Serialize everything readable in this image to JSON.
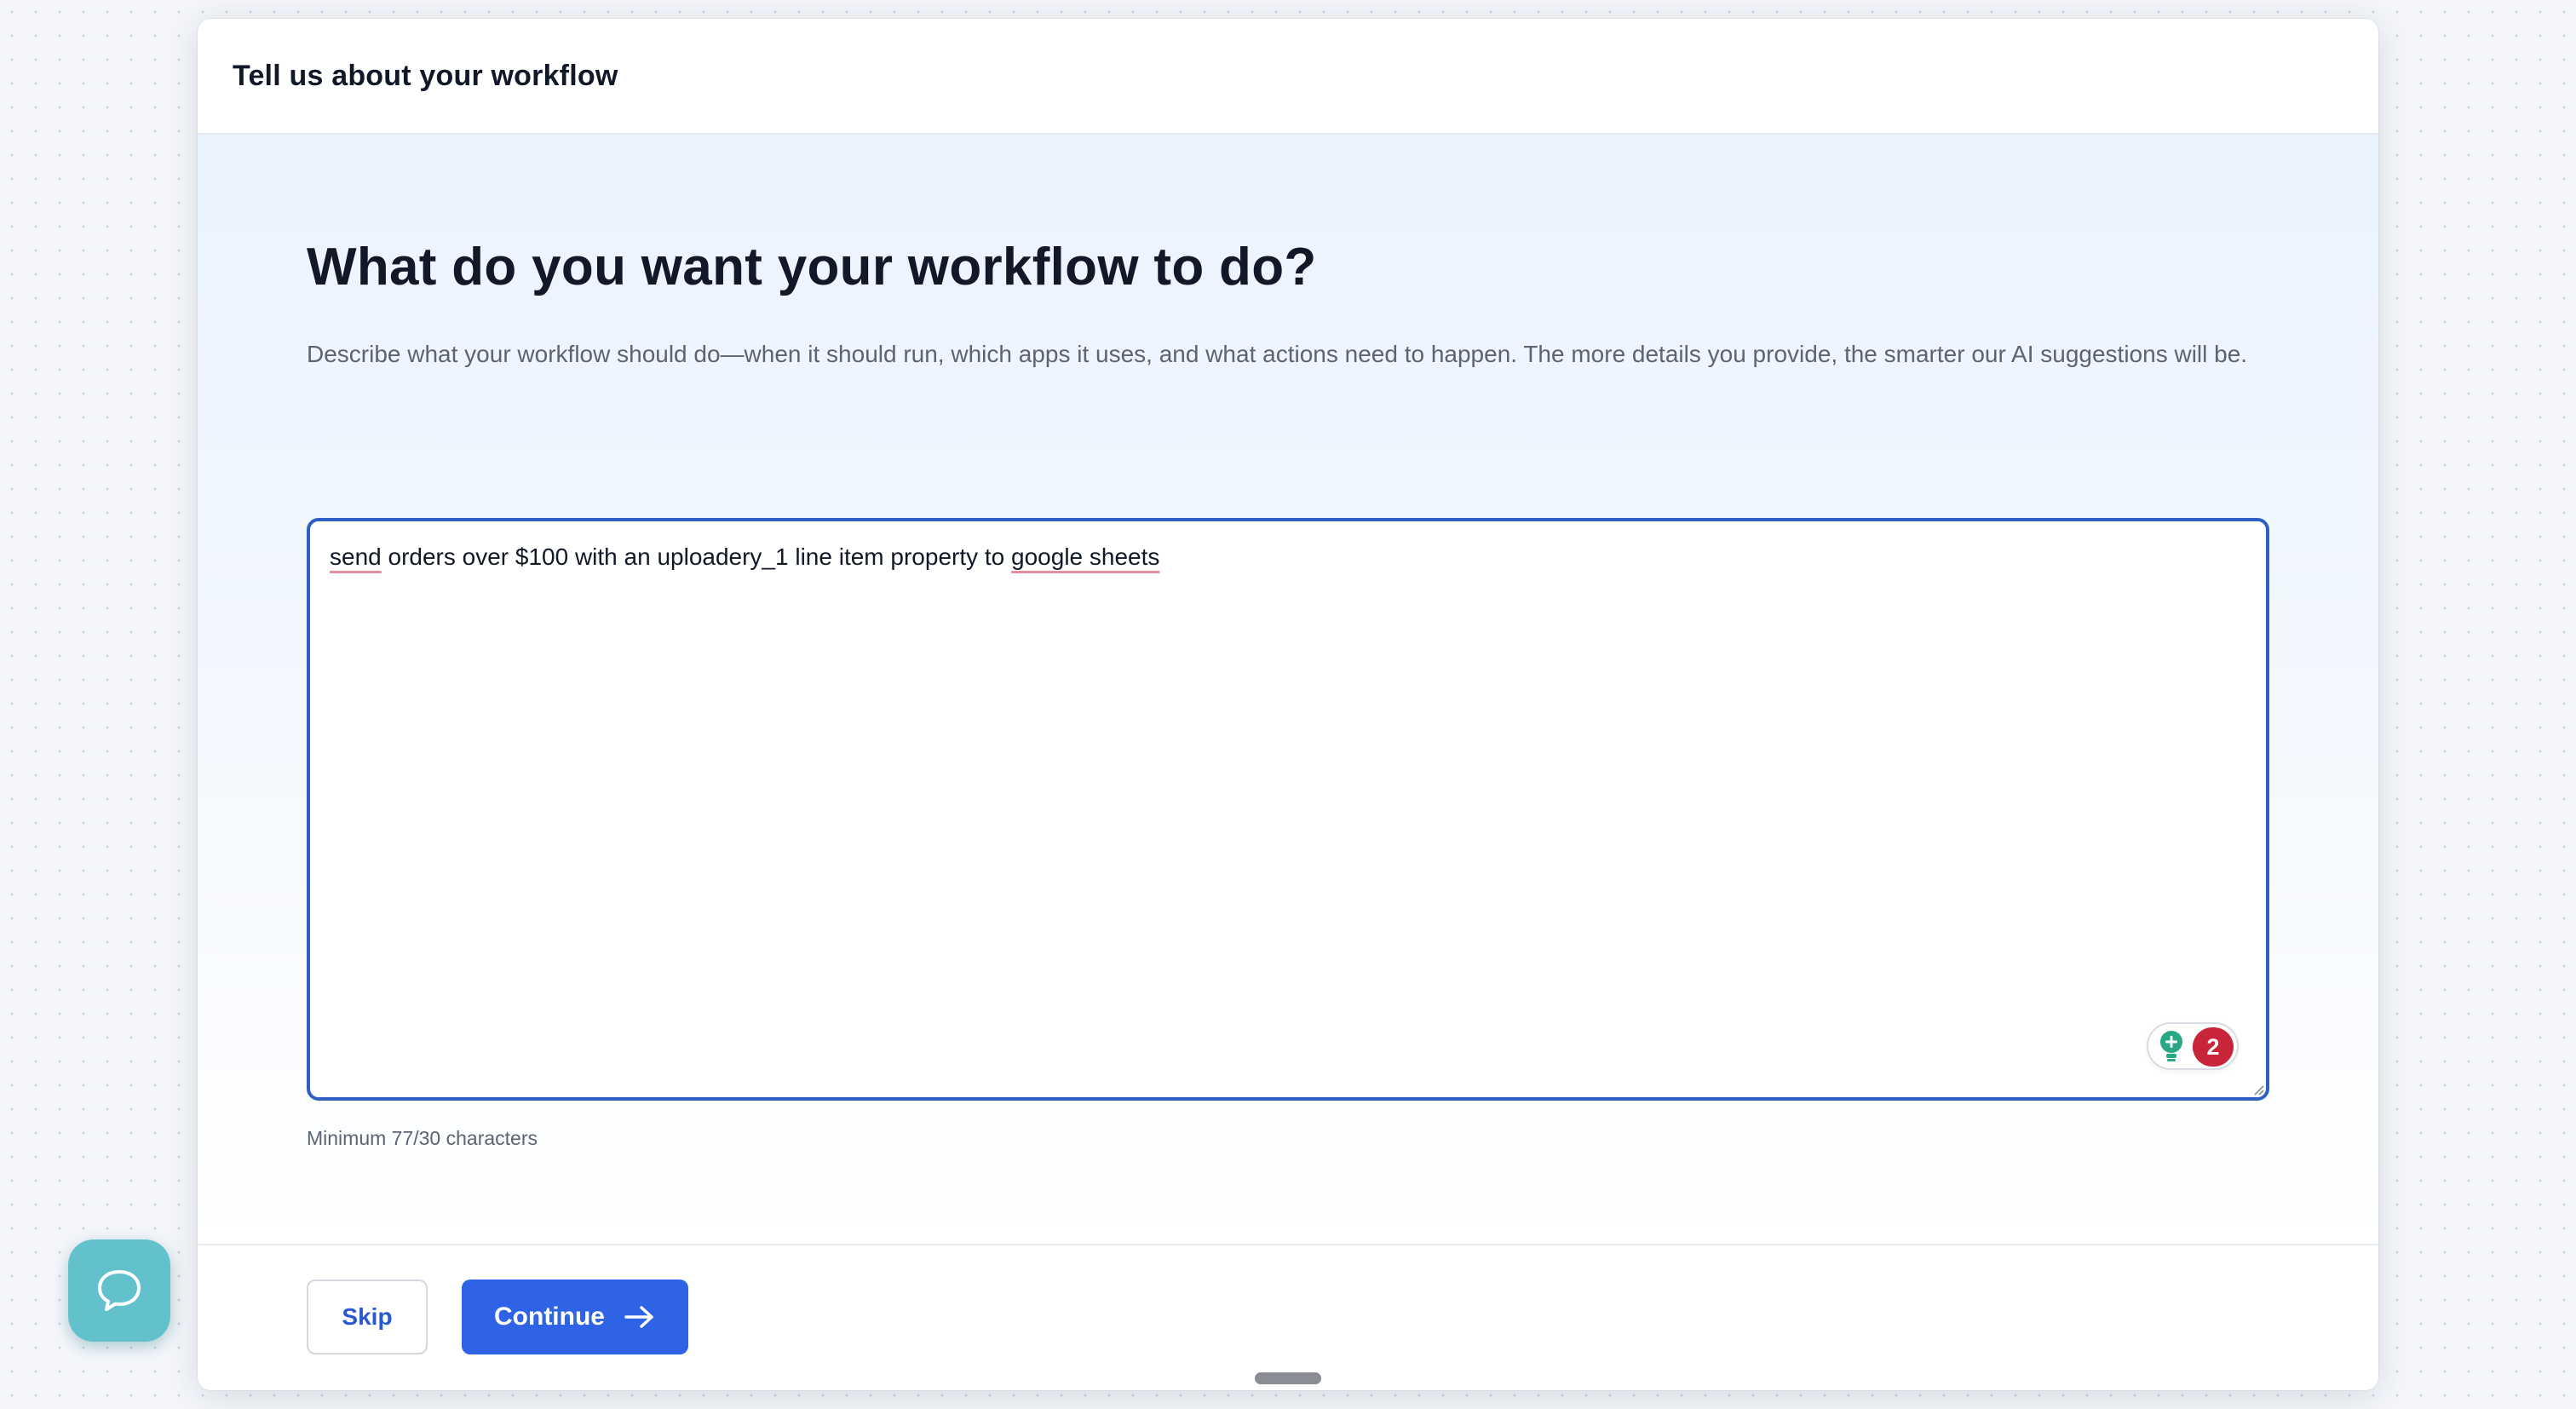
{
  "modal": {
    "title": "Tell us about your workflow"
  },
  "prompt": {
    "heading": "What do you want your workflow to do?",
    "description": "Describe what your workflow should do—when it should run, which apps it uses, and what actions need to happen. The more details you provide, the smarter our AI suggestions will be."
  },
  "textarea": {
    "segments": [
      {
        "text": "send",
        "flagged": true
      },
      {
        "text": " orders over $100 with an uploadery_1 line item property to ",
        "flagged": false
      },
      {
        "text": "google sheets",
        "flagged": true
      }
    ],
    "grammar_issue_count": "2"
  },
  "helper": {
    "text": "Minimum 77/30 characters"
  },
  "footer": {
    "skip_label": "Skip",
    "continue_label": "Continue"
  },
  "icons": {
    "grammar": "lightbulb-icon",
    "continue": "arrow-right-icon",
    "chat": "chat-bubble-icon"
  },
  "colors": {
    "primary": "#2f63e6",
    "focus_border": "#2f5ec4",
    "spell_underline": "#e58fa0",
    "issue_badge": "#c8243a",
    "chat_launcher": "#62c1cc"
  }
}
